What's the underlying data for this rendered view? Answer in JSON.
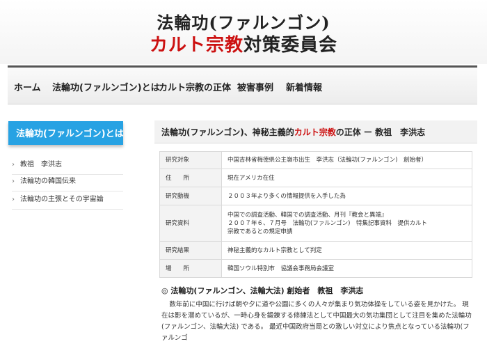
{
  "header": {
    "title_line1": "法輪功(ファルンゴン)",
    "title_line2_red": "カルト宗教",
    "title_line2_rest": "対策委員会"
  },
  "nav": {
    "items": [
      "ホーム",
      "法輪功(ファルンゴン)とは",
      "カルト宗教の正体",
      "被害事例",
      "新着情報"
    ]
  },
  "sidebar": {
    "heading": "法輪功(ファルンゴン)とは",
    "links": [
      "教祖　李洪志",
      "法輪功の韓国伝来",
      "法輪功の主張とその宇宙論"
    ]
  },
  "main": {
    "title_pre": "法輪功(ファルンゴン)、神秘主義的",
    "title_red": "カルト宗教",
    "title_post": "の正体 ー 教祖　李洪志",
    "table": [
      {
        "label": "研究対象",
        "value": "中国吉林省梅徳県公主嶺市出生　李洪志（法輪功(ファルンゴン)　創始者）"
      },
      {
        "label": "住　　所",
        "value": "現在アメリカ在住"
      },
      {
        "label": "研究動機",
        "value": "２００３年より多くの情報提供を入手した為"
      },
      {
        "label": "研究資料",
        "value": "中国での調査活動、韓国での調査活動、月刊『教会と異端』\n２００７年６、７月号　法輪功(ファルンゴン)　特集記事資料　提供カルト\n宗教であるとの規定申請"
      },
      {
        "label": "研究結果",
        "value": "神秘主義的なカルト宗教として判定"
      },
      {
        "label": "場　　所",
        "value": "韓国ソウル特別市　協議会事務局会議室"
      }
    ],
    "section_heading": "◎ 法輪功(ファルンゴン、法輪大法) 創始者　教祖　李洪志",
    "body_text": "数年前に中国に行けば朝や夕に道や公園に多くの人々が集まり気功体操をしている姿を見かけた。 現在は影を潜めているが、一時心身を鍛錬する修練法として中国最大の気功集団として注目を集めた法輪功(ファルンゴン、法輪大法) である。 最近中国政府当局との激しい対立により焦点となっている法輪功(ファルンゴ"
  }
}
